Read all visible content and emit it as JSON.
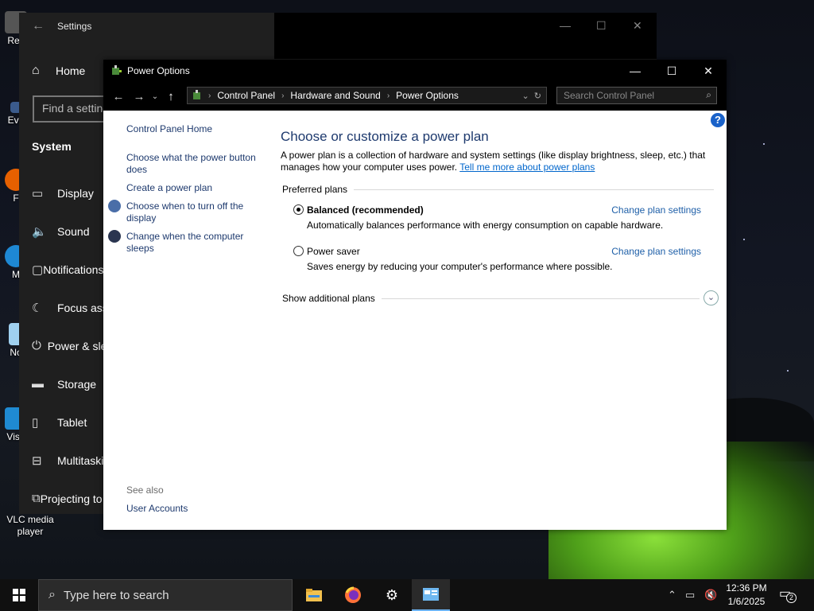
{
  "desktop": {
    "icons": [
      {
        "label": "Rec",
        "icon": "recycle-bin-icon"
      },
      {
        "label": "Eve",
        "icon": "app-shortcut-icon"
      },
      {
        "label": "F",
        "icon": "firefox-icon"
      },
      {
        "label": "M",
        "icon": "edge-icon"
      },
      {
        "label": "No",
        "icon": "notepad-icon"
      },
      {
        "label": "Visu",
        "icon": "vscode-icon"
      },
      {
        "label": "VLC media player",
        "icon": "vlc-icon"
      }
    ]
  },
  "settings": {
    "title": "Settings",
    "home": "Home",
    "search_placeholder": "Find a setting",
    "section": "System",
    "items": [
      {
        "label": "Display",
        "icon": "display-icon"
      },
      {
        "label": "Sound",
        "icon": "sound-icon"
      },
      {
        "label": "Notifications & actions",
        "icon": "notifications-icon"
      },
      {
        "label": "Focus assist",
        "icon": "focus-assist-icon"
      },
      {
        "label": "Power & sleep",
        "icon": "power-icon"
      },
      {
        "label": "Storage",
        "icon": "storage-icon"
      },
      {
        "label": "Tablet",
        "icon": "tablet-icon"
      },
      {
        "label": "Multitasking",
        "icon": "multitasking-icon"
      },
      {
        "label": "Projecting to this PC",
        "icon": "projecting-icon"
      }
    ]
  },
  "power": {
    "title": "Power Options",
    "breadcrumb": [
      "Control Panel",
      "Hardware and Sound",
      "Power Options"
    ],
    "search_placeholder": "Search Control Panel",
    "left_nav": {
      "home": "Control Panel Home",
      "links": [
        "Choose what the power button does",
        "Create a power plan",
        "Choose when to turn off the display",
        "Change when the computer sleeps"
      ],
      "see_also": "See also",
      "user_accounts": "User Accounts"
    },
    "heading": "Choose or customize a power plan",
    "description": "A power plan is a collection of hardware and system settings (like display brightness, sleep, etc.) that manages how your computer uses power.",
    "learn_more": "Tell me more about power plans",
    "preferred_plans": "Preferred plans",
    "plans": [
      {
        "name": "Balanced (recommended)",
        "description": "Automatically balances performance with energy consumption on capable hardware.",
        "selected": true,
        "change_link": "Change plan settings"
      },
      {
        "name": "Power saver",
        "description": "Saves energy by reducing your computer's performance where possible.",
        "selected": false,
        "change_link": "Change plan settings"
      }
    ],
    "additional_plans": "Show additional plans"
  },
  "taskbar": {
    "search_placeholder": "Type here to search",
    "apps": [
      "file-explorer-icon",
      "firefox-icon",
      "settings-gear-icon",
      "control-panel-icon"
    ],
    "time": "12:36 PM",
    "date": "1/6/2025",
    "notification_count": "2"
  }
}
